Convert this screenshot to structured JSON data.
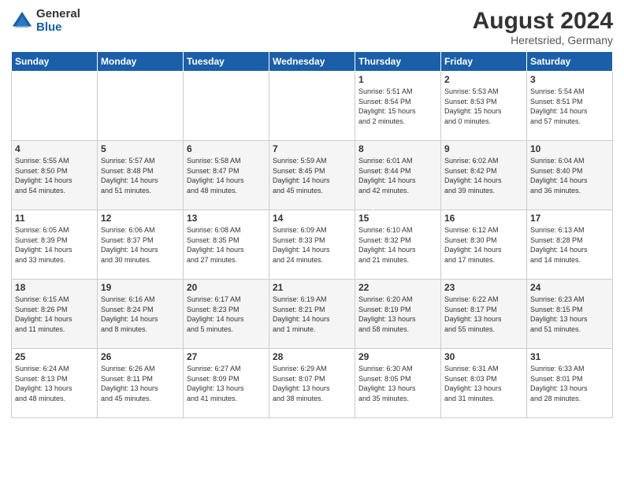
{
  "logo": {
    "general": "General",
    "blue": "Blue"
  },
  "title": "August 2024",
  "location": "Heretsried, Germany",
  "days_header": [
    "Sunday",
    "Monday",
    "Tuesday",
    "Wednesday",
    "Thursday",
    "Friday",
    "Saturday"
  ],
  "weeks": [
    [
      {
        "day": "",
        "info": ""
      },
      {
        "day": "",
        "info": ""
      },
      {
        "day": "",
        "info": ""
      },
      {
        "day": "",
        "info": ""
      },
      {
        "day": "1",
        "info": "Sunrise: 5:51 AM\nSunset: 8:54 PM\nDaylight: 15 hours\nand 2 minutes."
      },
      {
        "day": "2",
        "info": "Sunrise: 5:53 AM\nSunset: 8:53 PM\nDaylight: 15 hours\nand 0 minutes."
      },
      {
        "day": "3",
        "info": "Sunrise: 5:54 AM\nSunset: 8:51 PM\nDaylight: 14 hours\nand 57 minutes."
      }
    ],
    [
      {
        "day": "4",
        "info": "Sunrise: 5:55 AM\nSunset: 8:50 PM\nDaylight: 14 hours\nand 54 minutes."
      },
      {
        "day": "5",
        "info": "Sunrise: 5:57 AM\nSunset: 8:48 PM\nDaylight: 14 hours\nand 51 minutes."
      },
      {
        "day": "6",
        "info": "Sunrise: 5:58 AM\nSunset: 8:47 PM\nDaylight: 14 hours\nand 48 minutes."
      },
      {
        "day": "7",
        "info": "Sunrise: 5:59 AM\nSunset: 8:45 PM\nDaylight: 14 hours\nand 45 minutes."
      },
      {
        "day": "8",
        "info": "Sunrise: 6:01 AM\nSunset: 8:44 PM\nDaylight: 14 hours\nand 42 minutes."
      },
      {
        "day": "9",
        "info": "Sunrise: 6:02 AM\nSunset: 8:42 PM\nDaylight: 14 hours\nand 39 minutes."
      },
      {
        "day": "10",
        "info": "Sunrise: 6:04 AM\nSunset: 8:40 PM\nDaylight: 14 hours\nand 36 minutes."
      }
    ],
    [
      {
        "day": "11",
        "info": "Sunrise: 6:05 AM\nSunset: 8:39 PM\nDaylight: 14 hours\nand 33 minutes."
      },
      {
        "day": "12",
        "info": "Sunrise: 6:06 AM\nSunset: 8:37 PM\nDaylight: 14 hours\nand 30 minutes."
      },
      {
        "day": "13",
        "info": "Sunrise: 6:08 AM\nSunset: 8:35 PM\nDaylight: 14 hours\nand 27 minutes."
      },
      {
        "day": "14",
        "info": "Sunrise: 6:09 AM\nSunset: 8:33 PM\nDaylight: 14 hours\nand 24 minutes."
      },
      {
        "day": "15",
        "info": "Sunrise: 6:10 AM\nSunset: 8:32 PM\nDaylight: 14 hours\nand 21 minutes."
      },
      {
        "day": "16",
        "info": "Sunrise: 6:12 AM\nSunset: 8:30 PM\nDaylight: 14 hours\nand 17 minutes."
      },
      {
        "day": "17",
        "info": "Sunrise: 6:13 AM\nSunset: 8:28 PM\nDaylight: 14 hours\nand 14 minutes."
      }
    ],
    [
      {
        "day": "18",
        "info": "Sunrise: 6:15 AM\nSunset: 8:26 PM\nDaylight: 14 hours\nand 11 minutes."
      },
      {
        "day": "19",
        "info": "Sunrise: 6:16 AM\nSunset: 8:24 PM\nDaylight: 14 hours\nand 8 minutes."
      },
      {
        "day": "20",
        "info": "Sunrise: 6:17 AM\nSunset: 8:23 PM\nDaylight: 14 hours\nand 5 minutes."
      },
      {
        "day": "21",
        "info": "Sunrise: 6:19 AM\nSunset: 8:21 PM\nDaylight: 14 hours\nand 1 minute."
      },
      {
        "day": "22",
        "info": "Sunrise: 6:20 AM\nSunset: 8:19 PM\nDaylight: 13 hours\nand 58 minutes."
      },
      {
        "day": "23",
        "info": "Sunrise: 6:22 AM\nSunset: 8:17 PM\nDaylight: 13 hours\nand 55 minutes."
      },
      {
        "day": "24",
        "info": "Sunrise: 6:23 AM\nSunset: 8:15 PM\nDaylight: 13 hours\nand 51 minutes."
      }
    ],
    [
      {
        "day": "25",
        "info": "Sunrise: 6:24 AM\nSunset: 8:13 PM\nDaylight: 13 hours\nand 48 minutes."
      },
      {
        "day": "26",
        "info": "Sunrise: 6:26 AM\nSunset: 8:11 PM\nDaylight: 13 hours\nand 45 minutes."
      },
      {
        "day": "27",
        "info": "Sunrise: 6:27 AM\nSunset: 8:09 PM\nDaylight: 13 hours\nand 41 minutes."
      },
      {
        "day": "28",
        "info": "Sunrise: 6:29 AM\nSunset: 8:07 PM\nDaylight: 13 hours\nand 38 minutes."
      },
      {
        "day": "29",
        "info": "Sunrise: 6:30 AM\nSunset: 8:05 PM\nDaylight: 13 hours\nand 35 minutes."
      },
      {
        "day": "30",
        "info": "Sunrise: 6:31 AM\nSunset: 8:03 PM\nDaylight: 13 hours\nand 31 minutes."
      },
      {
        "day": "31",
        "info": "Sunrise: 6:33 AM\nSunset: 8:01 PM\nDaylight: 13 hours\nand 28 minutes."
      }
    ]
  ]
}
